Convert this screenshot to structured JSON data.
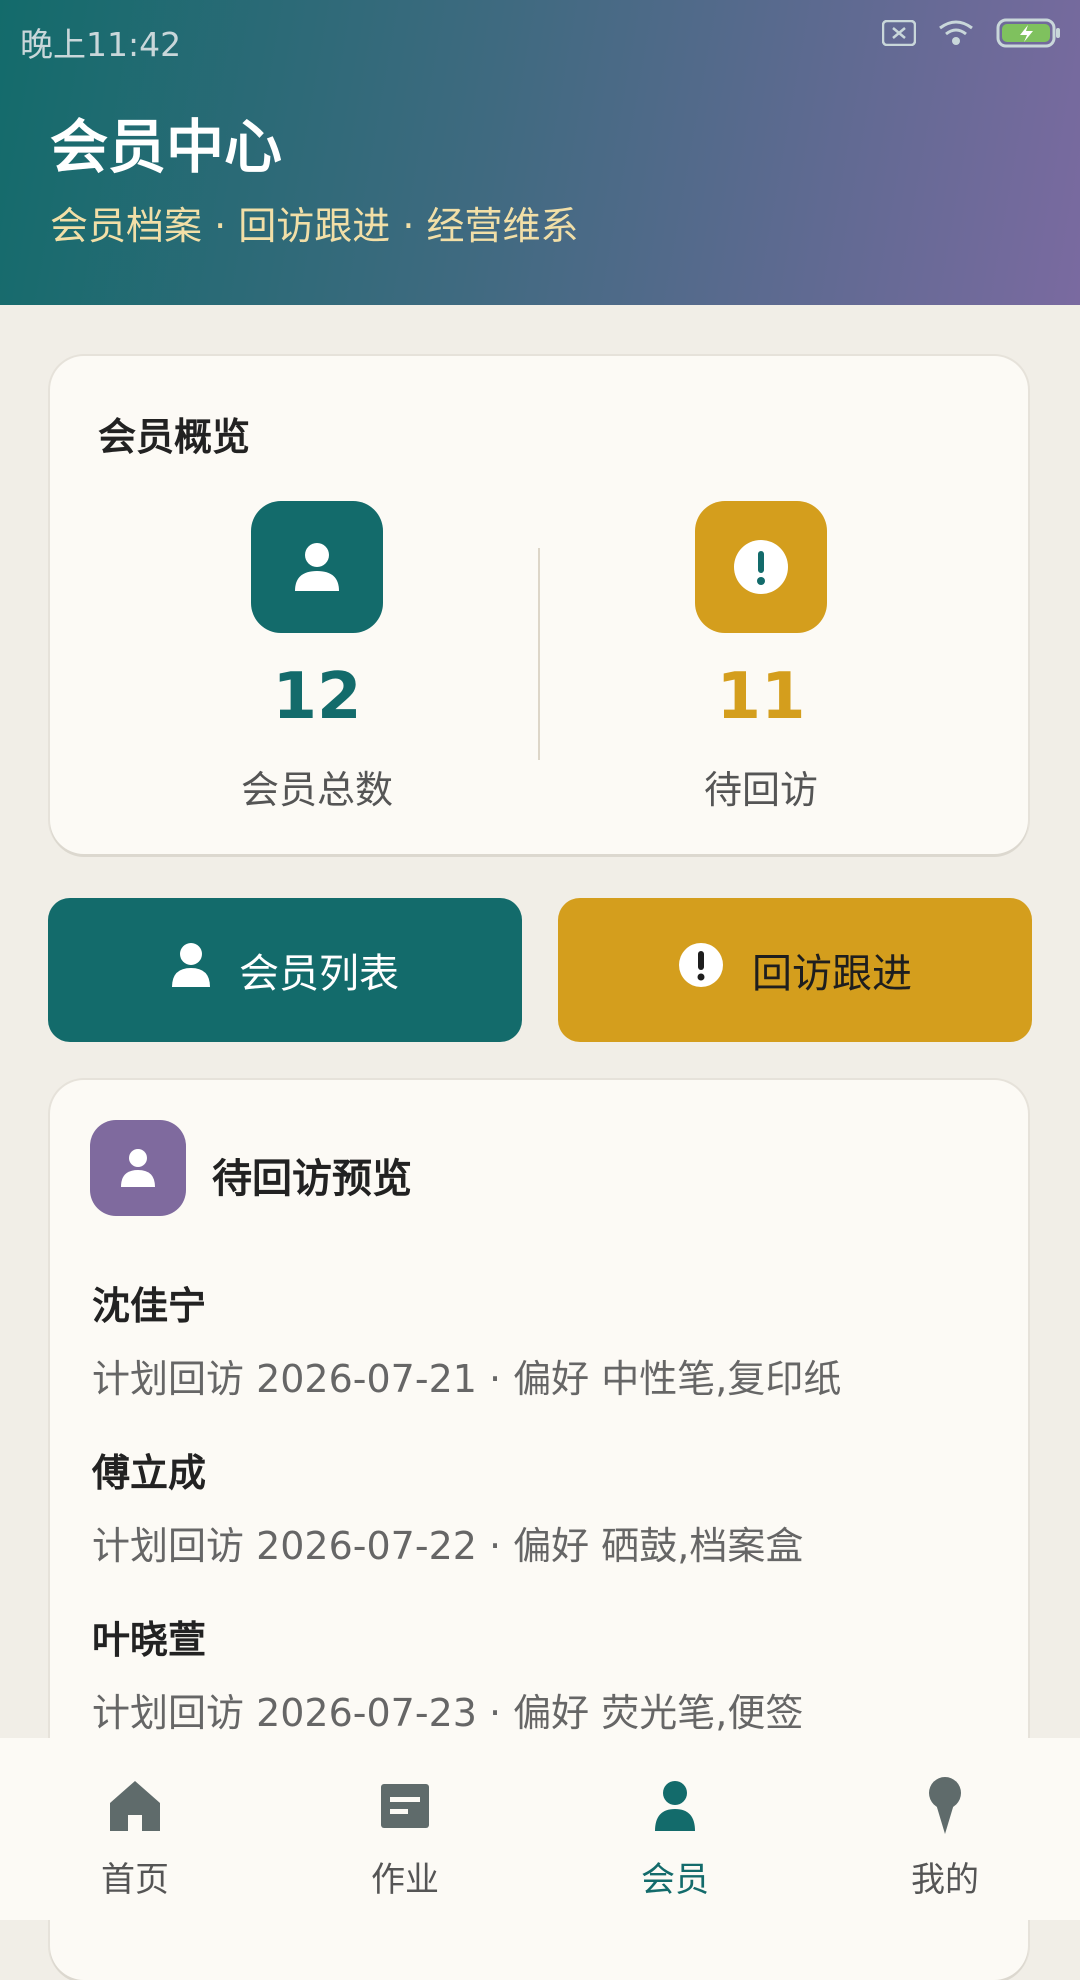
{
  "status_bar": {
    "time": "晚上11:42"
  },
  "header": {
    "title": "会员中心",
    "subtitle": "会员档案 · 回访跟进 · 经营维系"
  },
  "overview": {
    "title": "会员概览",
    "stats": [
      {
        "value": "12",
        "label": "会员总数",
        "icon": "person-icon",
        "color": "#136B6B"
      },
      {
        "value": "11",
        "label": "待回访",
        "icon": "alert-icon",
        "color": "#D49E1D"
      }
    ]
  },
  "actions": {
    "member_list": "会员列表",
    "follow_up": "回访跟进"
  },
  "preview": {
    "title": "待回访预览",
    "items": [
      {
        "name": "沈佳宁",
        "detail": "计划回访 2026-07-21 · 偏好 中性笔,复印纸"
      },
      {
        "name": "傅立成",
        "detail": "计划回访 2026-07-22 · 偏好 硒鼓,档案盒"
      },
      {
        "name": "叶晓萱",
        "detail": "计划回访 2026-07-23 · 偏好 荧光笔,便签"
      }
    ]
  },
  "nav": {
    "items": [
      {
        "label": "首页",
        "icon": "home-icon"
      },
      {
        "label": "作业",
        "icon": "document-icon"
      },
      {
        "label": "会员",
        "icon": "person-icon",
        "active": true
      },
      {
        "label": "我的",
        "icon": "location-pin-icon"
      }
    ]
  },
  "colors": {
    "primary": "#136B6B",
    "accent": "#D49E1D",
    "purple": "#7F6A9E",
    "background": "#F1EEE7"
  }
}
